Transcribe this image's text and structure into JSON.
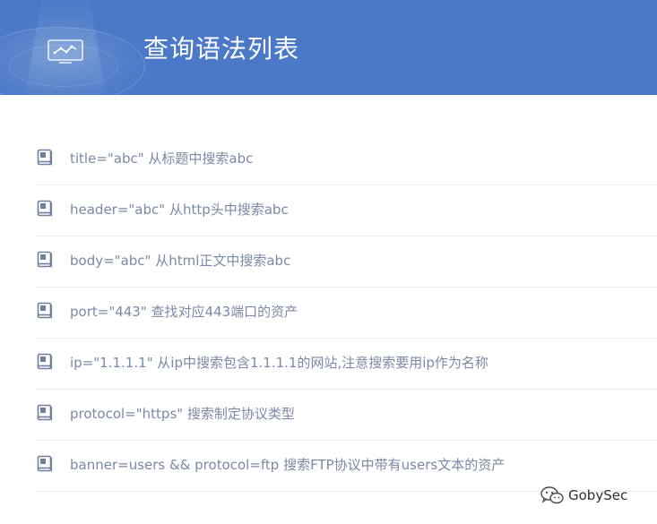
{
  "header": {
    "title": "查询语法列表",
    "icon": "chart-monitor-icon",
    "color": "#4a79c7"
  },
  "syntax_list": [
    {
      "text": "title=\"abc\" 从标题中搜索abc",
      "icon": "book-icon"
    },
    {
      "text": "header=\"abc\" 从http头中搜索abc",
      "icon": "book-icon"
    },
    {
      "text": "body=\"abc\" 从html正文中搜索abc",
      "icon": "book-icon"
    },
    {
      "text": "port=\"443\" 查找对应443端口的资产",
      "icon": "book-icon"
    },
    {
      "text": "ip=\"1.1.1.1\" 从ip中搜索包含1.1.1.1的网站,注意搜索要用ip作为名称",
      "icon": "book-icon"
    },
    {
      "text": "protocol=\"https\" 搜索制定协议类型",
      "icon": "book-icon"
    },
    {
      "text": "banner=users && protocol=ftp 搜索FTP协议中带有users文本的资产",
      "icon": "book-icon"
    }
  ],
  "watermark": {
    "text": "GobySec",
    "icon": "wechat-icon"
  }
}
